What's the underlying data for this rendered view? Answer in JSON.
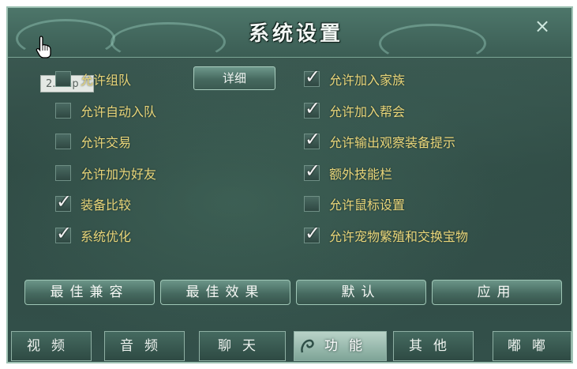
{
  "dialog": {
    "title": "系统设置",
    "close_label": "×"
  },
  "tooltip": {
    "text": "2.bmp"
  },
  "options_left": [
    {
      "label": "允许组队",
      "checked": false
    },
    {
      "label": "允许自动入队",
      "checked": false
    },
    {
      "label": "允许交易",
      "checked": false
    },
    {
      "label": "允许加为好友",
      "checked": false
    },
    {
      "label": "装备比较",
      "checked": true
    },
    {
      "label": "系统优化",
      "checked": true
    }
  ],
  "options_right": [
    {
      "label": "允许加入家族",
      "checked": true
    },
    {
      "label": "允许加入帮会",
      "checked": true
    },
    {
      "label": "允许输出观察装备提示",
      "checked": true
    },
    {
      "label": "额外技能栏",
      "checked": true
    },
    {
      "label": "允许鼠标设置",
      "checked": false
    },
    {
      "label": "允许宠物繁殖和交换宝物",
      "checked": true
    }
  ],
  "detail_button": "详细",
  "check_mark": "✓",
  "actions": {
    "best_compat": "最佳兼容",
    "best_effect": "最佳效果",
    "default": "默认",
    "apply": "应用"
  },
  "tabs": [
    {
      "label": "视频",
      "active": false
    },
    {
      "label": "音频",
      "active": false
    },
    {
      "label": "聊天",
      "active": false
    },
    {
      "label": "功能",
      "active": true
    },
    {
      "label": "其他",
      "active": false
    },
    {
      "label": "嘟嘟",
      "active": false
    }
  ],
  "colors": {
    "option_text": "#e9d67a",
    "panel_bg": "#2f4a44",
    "border": "#9fc2b4"
  },
  "icons": {
    "cursor": "hand-pointer-icon",
    "close": "close-icon",
    "check": "check-icon",
    "active_tab_emblem": "swirl-icon"
  }
}
